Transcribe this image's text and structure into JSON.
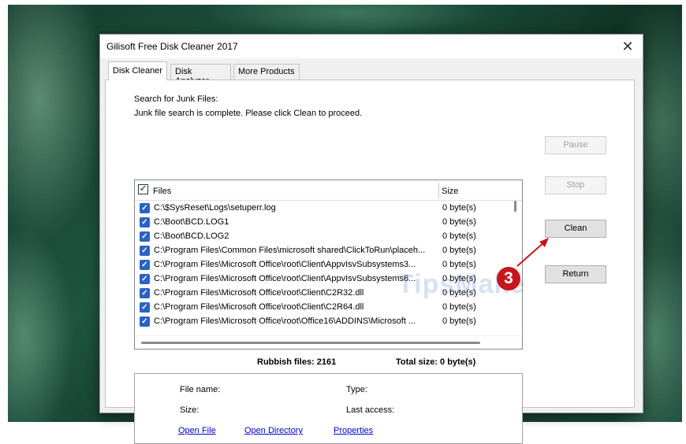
{
  "window": {
    "title": "Gilisoft Free Disk Cleaner 2017",
    "close_label": "✕"
  },
  "tabs": [
    {
      "label": "Disk Cleaner",
      "active": true
    },
    {
      "label": "Disk Analyzer",
      "active": false
    },
    {
      "label": "More Products",
      "active": false
    }
  ],
  "status": {
    "heading": "Search for Junk Files:",
    "message": "Junk file search is complete. Please click Clean to proceed."
  },
  "list": {
    "header_check": "✓",
    "columns": {
      "files": "Files",
      "size": "Size"
    },
    "rows": [
      {
        "path": "C:\\$SysReset\\Logs\\setuperr.log",
        "size": "0 byte(s)",
        "checked": true
      },
      {
        "path": "C:\\Boot\\BCD.LOG1",
        "size": "0 byte(s)",
        "checked": true
      },
      {
        "path": "C:\\Boot\\BCD.LOG2",
        "size": "0 byte(s)",
        "checked": true
      },
      {
        "path": "C:\\Program Files\\Common Files\\microsoft shared\\ClickToRun\\placeh...",
        "size": "0 byte(s)",
        "checked": true
      },
      {
        "path": "C:\\Program Files\\Microsoft Office\\root\\Client\\AppvIsvSubsystems3...",
        "size": "0 byte(s)",
        "checked": true
      },
      {
        "path": "C:\\Program Files\\Microsoft Office\\root\\Client\\AppvIsvSubsystems6...",
        "size": "0 byte(s)",
        "checked": true
      },
      {
        "path": "C:\\Program Files\\Microsoft Office\\root\\Client\\C2R32.dll",
        "size": "0 byte(s)",
        "checked": true
      },
      {
        "path": "C:\\Program Files\\Microsoft Office\\root\\Client\\C2R64.dll",
        "size": "0 byte(s)",
        "checked": true
      },
      {
        "path": "C:\\Program Files\\Microsoft Office\\root\\Office16\\ADDINS\\Microsoft ...",
        "size": "0 byte(s)",
        "checked": true
      }
    ],
    "check_glyph": "✓"
  },
  "summary": {
    "rubbish_files": "Rubbish files: 2161",
    "total_size": "Total size:  0 byte(s)"
  },
  "details": {
    "file_name_label": "File name:",
    "type_label": "Type:",
    "size_label": "Size:",
    "last_access_label": "Last  access:",
    "open_file_link": "Open File",
    "open_directory_link": "Open Directory",
    "properties_link": "Properties"
  },
  "buttons": {
    "pause": {
      "label": "Pause",
      "enabled": false
    },
    "stop": {
      "label": "Stop",
      "enabled": false
    },
    "clean": {
      "label": "Clean",
      "enabled": true
    },
    "return": {
      "label": "Return",
      "enabled": true
    }
  },
  "annotation": {
    "step_number": "3",
    "color": "#c8161e"
  },
  "watermark": {
    "text": "TipsMake"
  }
}
